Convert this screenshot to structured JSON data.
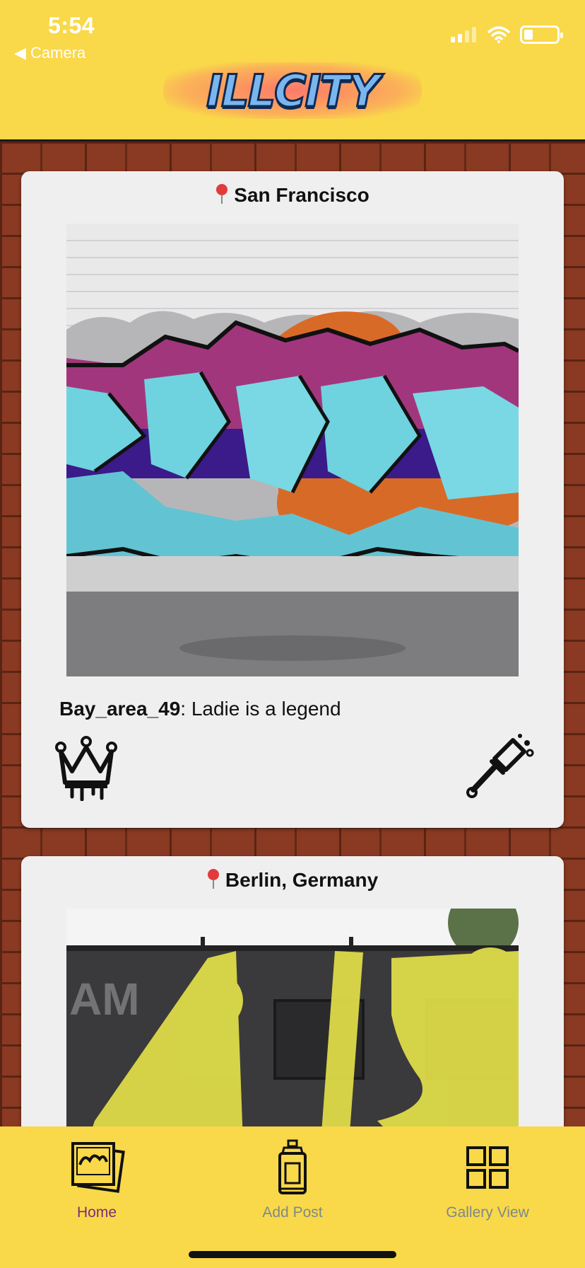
{
  "status_bar": {
    "time": "5:54",
    "back_label": "◀ Camera",
    "icons": [
      "signal-icon",
      "wifi-icon",
      "battery-icon"
    ]
  },
  "app": {
    "logo_text": "ILLCITY",
    "header_color": "#f9d84a",
    "accent": "#7a2d7a"
  },
  "posts": [
    {
      "location": "San Francisco",
      "username": "Bay_area_49",
      "caption": ": Ladie is a legend",
      "actions": [
        "crown-icon",
        "paint-roller-icon"
      ]
    },
    {
      "location": "Berlin, Germany"
    }
  ],
  "tabbar": {
    "tabs": [
      {
        "label": "Home",
        "icon": "photo-stack-icon",
        "active": true
      },
      {
        "label": "Add Post",
        "icon": "spray-can-icon",
        "active": false
      },
      {
        "label": "Gallery View",
        "icon": "grid-icon",
        "active": false
      }
    ]
  }
}
